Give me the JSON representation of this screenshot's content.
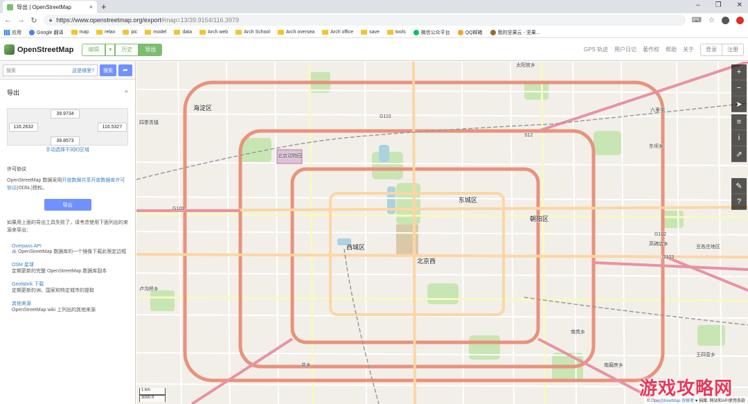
{
  "browser": {
    "tab_title": "导出 | OpenStreetMap",
    "tab_close": "×",
    "new_tab": "+",
    "win_min": "–",
    "win_max": "❐",
    "win_close": "✕",
    "url_main": "https://www.openstreetmap.org/export",
    "url_hash": "#map=13/39.9154/116.3979",
    "bookmarks": [
      "应用",
      "Google 翻译",
      "map",
      "relax",
      "pic",
      "model",
      "data",
      "Arch web",
      "Arch School",
      "Arch oversea",
      "Arch office",
      "save",
      "tools",
      "微信公众平台",
      "QQ邮箱",
      "我的坚果云 - 坚果..."
    ]
  },
  "osm": {
    "logo": "OpenStreetMap",
    "edit": "编辑",
    "edit_drop": "▾",
    "history": "历史",
    "export": "导出",
    "nav": [
      "GPS 轨迹",
      "用户日记",
      "著作权",
      "帮助",
      "关于"
    ],
    "login": "登录",
    "signup": "注册"
  },
  "sidebar": {
    "search_placeholder": "搜索",
    "where_am_i": "这是哪里?",
    "go": "搜索",
    "directions_icon": "➦",
    "panel_title": "导出",
    "close": "×",
    "north": "39.9734",
    "west": "116.2632",
    "east": "116.5327",
    "south": "39.8573",
    "manual_select": "手动选择不同的区域",
    "license_title": "许可协议",
    "license_pre": "OpenStreetMap 数据采用",
    "license_link": "开放数据共享开放数据库许可协议",
    "license_post": "(ODbL)授权。",
    "export_button": "导出",
    "other_sources": "如果用上面的导出工具失败了，请考虑使用下面列出的来源来导出：",
    "sources": [
      {
        "title": "Overpass API",
        "desc": "从 OpenStreetMap 数据库的一个镜像下载此限定边框"
      },
      {
        "title": "OSM 星球",
        "desc": "定期更新的完整 OpenStreetMap 数据库副本"
      },
      {
        "title": "Geofabrik 下载",
        "desc": "定期更新的洲、国家和特定城市的提取"
      },
      {
        "title": "其他来源",
        "desc": "OpenStreetMap wiki 上列出的其他来源"
      }
    ]
  },
  "map": {
    "labels": [
      "海淀区",
      "西城区",
      "东城区",
      "朝阳区",
      "北京西",
      "四季青镇",
      "北京动物园",
      "太阳宫乡",
      "东坝乡",
      "高碑店乡",
      "豆各庄地区",
      "王四营乡",
      "卢沟桥乡",
      "花乡",
      "南苑乡",
      "六里屯",
      "南磨房乡"
    ],
    "roads": [
      "G110",
      "G109",
      "S12",
      "G102",
      "G103"
    ],
    "scale_km": "1 km",
    "scale_ft": "3000 ft",
    "attribution_pre": "© ",
    "attribution_link": "OpenStreetMap 贡献者",
    "attribution_post": " ♥ 捐赠. 网站和API使用条款",
    "watermark": "游戏攻略网",
    "ctl_zoom_in": "+",
    "ctl_zoom_out": "−",
    "ctl_locate": "➤",
    "ctl_layers": "≡",
    "ctl_info": "i",
    "ctl_share": "⇗",
    "ctl_note": "✎",
    "ctl_query": "?"
  }
}
